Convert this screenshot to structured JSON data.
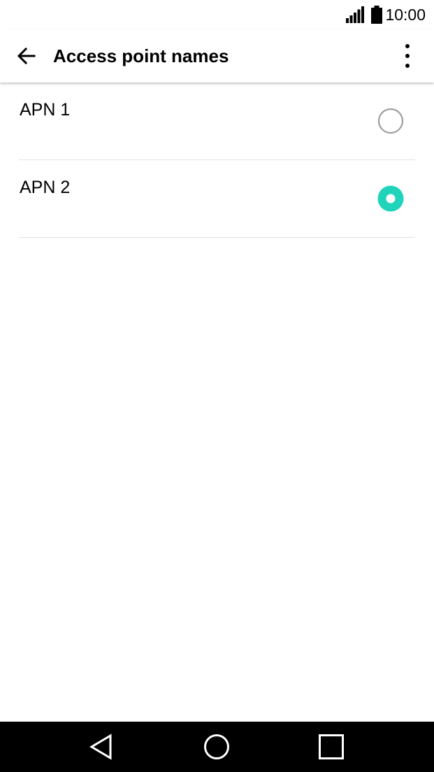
{
  "status_bar": {
    "time": "10:00",
    "icons": [
      "signal-icon",
      "battery-icon"
    ]
  },
  "app_bar": {
    "title": "Access point names",
    "back_icon": "arrow-back-icon",
    "menu_icon": "more-vertical-icon"
  },
  "apn_list": [
    {
      "label": "APN 1",
      "selected": false
    },
    {
      "label": "APN 2",
      "selected": true
    }
  ],
  "colors": {
    "accent": "#1fd4bb",
    "radio_unchecked": "#9e9e9e",
    "divider": "#e2e2e2",
    "nav_bar": "#000000"
  },
  "nav_bar": {
    "icons": [
      "nav-back-icon",
      "nav-home-icon",
      "nav-recents-icon"
    ]
  }
}
